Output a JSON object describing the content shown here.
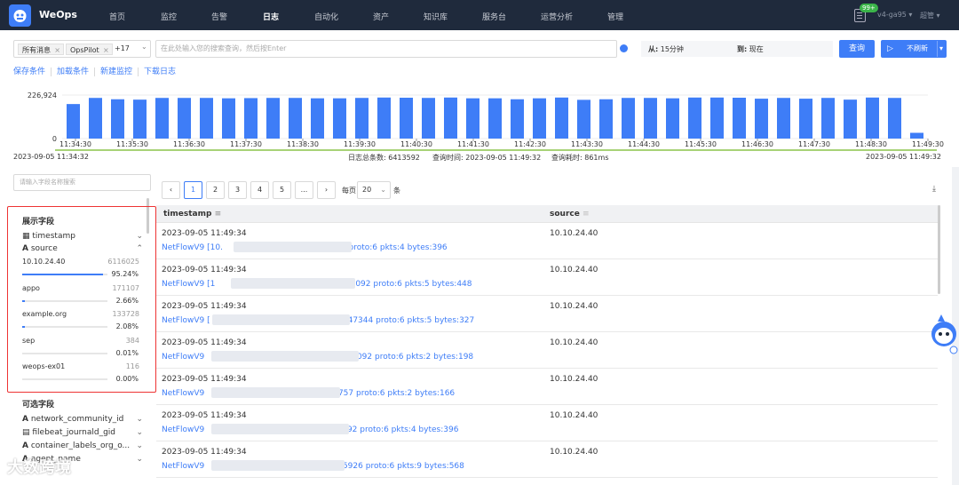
{
  "nav": {
    "brand": "WeOps",
    "menu": [
      "首页",
      "监控",
      "告警",
      "日志",
      "自动化",
      "资产",
      "知识库",
      "服务台",
      "运营分析",
      "管理"
    ],
    "active_index": 3,
    "badge": "99+",
    "version": "v4-ga95",
    "user": "超管"
  },
  "query": {
    "tags": [
      "所有消息",
      "OpsPilot"
    ],
    "more_count": "+17",
    "placeholder": "在此处输入您的搜索查询，然后按Enter",
    "from_label": "从:",
    "from_value": "15分钟",
    "to_label": "到:",
    "to_value": "现在",
    "search_btn": "查询",
    "refresh_btn": "不刷新",
    "links": [
      "保存条件",
      "加载条件",
      "新建监控",
      "下载日志"
    ]
  },
  "histogram": {
    "y_max_label": "226,924",
    "y_zero_label": "0",
    "x_labels": [
      "11:34:30",
      "11:35:30",
      "11:36:30",
      "11:37:30",
      "11:38:30",
      "11:39:30",
      "11:40:30",
      "11:41:30",
      "11:42:30",
      "11:43:30",
      "11:44:30",
      "11:45:30",
      "11:46:30",
      "11:47:30",
      "11:48:30",
      "11:49:30"
    ],
    "start_time": "2023-09-05 11:34:32",
    "end_time": "2023-09-05 11:49:32",
    "total_label": "日志总条数:",
    "total_value": "6413592",
    "qtime_label": "查询时间:",
    "qtime_value": "2023-09-05 11:49:32",
    "cost_label": "查询耗时:",
    "cost_value": "861ms"
  },
  "chart_data": {
    "type": "bar",
    "ylim": [
      0,
      226924
    ],
    "values": [
      180000,
      212000,
      205000,
      203000,
      212000,
      212000,
      212000,
      210000,
      211000,
      212000,
      212000,
      210000,
      210000,
      212000,
      214000,
      213000,
      212000,
      214000,
      210000,
      210000,
      205000,
      210000,
      214000,
      202000,
      205000,
      212000,
      212000,
      210000,
      214000,
      214000,
      213000,
      208000,
      212000,
      208000,
      212000,
      203000,
      214000,
      212000,
      30000
    ]
  },
  "fields": {
    "search_placeholder": "请输入字段名称搜索",
    "shown_title": "展示字段",
    "shown": [
      {
        "name": "timestamp",
        "icon": "calendar-icon"
      },
      {
        "name": "source",
        "icon": "text-type-icon"
      }
    ],
    "source_values": [
      {
        "name": "10.10.24.40",
        "count": "6116025",
        "pct": "95.24%",
        "frac": 0.9524
      },
      {
        "name": "appo",
        "count": "171107",
        "pct": "2.66%",
        "frac": 0.0266
      },
      {
        "name": "example.org",
        "count": "133728",
        "pct": "2.08%",
        "frac": 0.0208
      },
      {
        "name": "sep",
        "count": "384",
        "pct": "0.01%",
        "frac": 0.0001
      },
      {
        "name": "weops-ex01",
        "count": "116",
        "pct": "0.00%",
        "frac": 0.0
      }
    ],
    "optional_title": "可选字段",
    "optional": [
      "network_community_id",
      "filebeat_journald_gid",
      "container_labels_org_o...",
      "agent_name"
    ]
  },
  "pager": {
    "pages": [
      "1",
      "2",
      "3",
      "4",
      "5",
      "..."
    ],
    "per_page_label": "每页",
    "per_page": "20",
    "unit": "条"
  },
  "table": {
    "col_timestamp": "timestamp",
    "col_source": "source",
    "rows": [
      {
        "ts": "2023-09-05 11:49:34",
        "msg_a": "NetFlowV9 [10.",
        "msg_b": "2 proto:6 pkts:4 bytes:396",
        "src": "10.10.24.40"
      },
      {
        "ts": "2023-09-05 11:49:34",
        "msg_a": "NetFlowV9 [1",
        "msg_b": "7]:9092 proto:6 pkts:5 bytes:448",
        "src": "10.10.24.40"
      },
      {
        "ts": "2023-09-05 11:49:34",
        "msg_a": "NetFlowV9 [",
        "msg_b": "47344 proto:6 pkts:5 bytes:327",
        "src": "10.10.24.40"
      },
      {
        "ts": "2023-09-05 11:49:34",
        "msg_a": "NetFlowV9",
        "msg_b": "9092 proto:6 pkts:2 bytes:198",
        "src": "10.10.24.40"
      },
      {
        "ts": "2023-09-05 11:49:34",
        "msg_a": "NetFlowV9",
        "msg_b": "3757 proto:6 pkts:2 bytes:166",
        "src": "10.10.24.40"
      },
      {
        "ts": "2023-09-05 11:49:34",
        "msg_a": "NetFlowV9",
        "msg_b": "092 proto:6 pkts:4 bytes:396",
        "src": "10.10.24.40"
      },
      {
        "ts": "2023-09-05 11:49:34",
        "msg_a": "NetFlowV9",
        "msg_b": "55926 proto:6 pkts:9 bytes:568",
        "src": "10.10.24.40"
      }
    ]
  },
  "watermark": "大数跨境"
}
